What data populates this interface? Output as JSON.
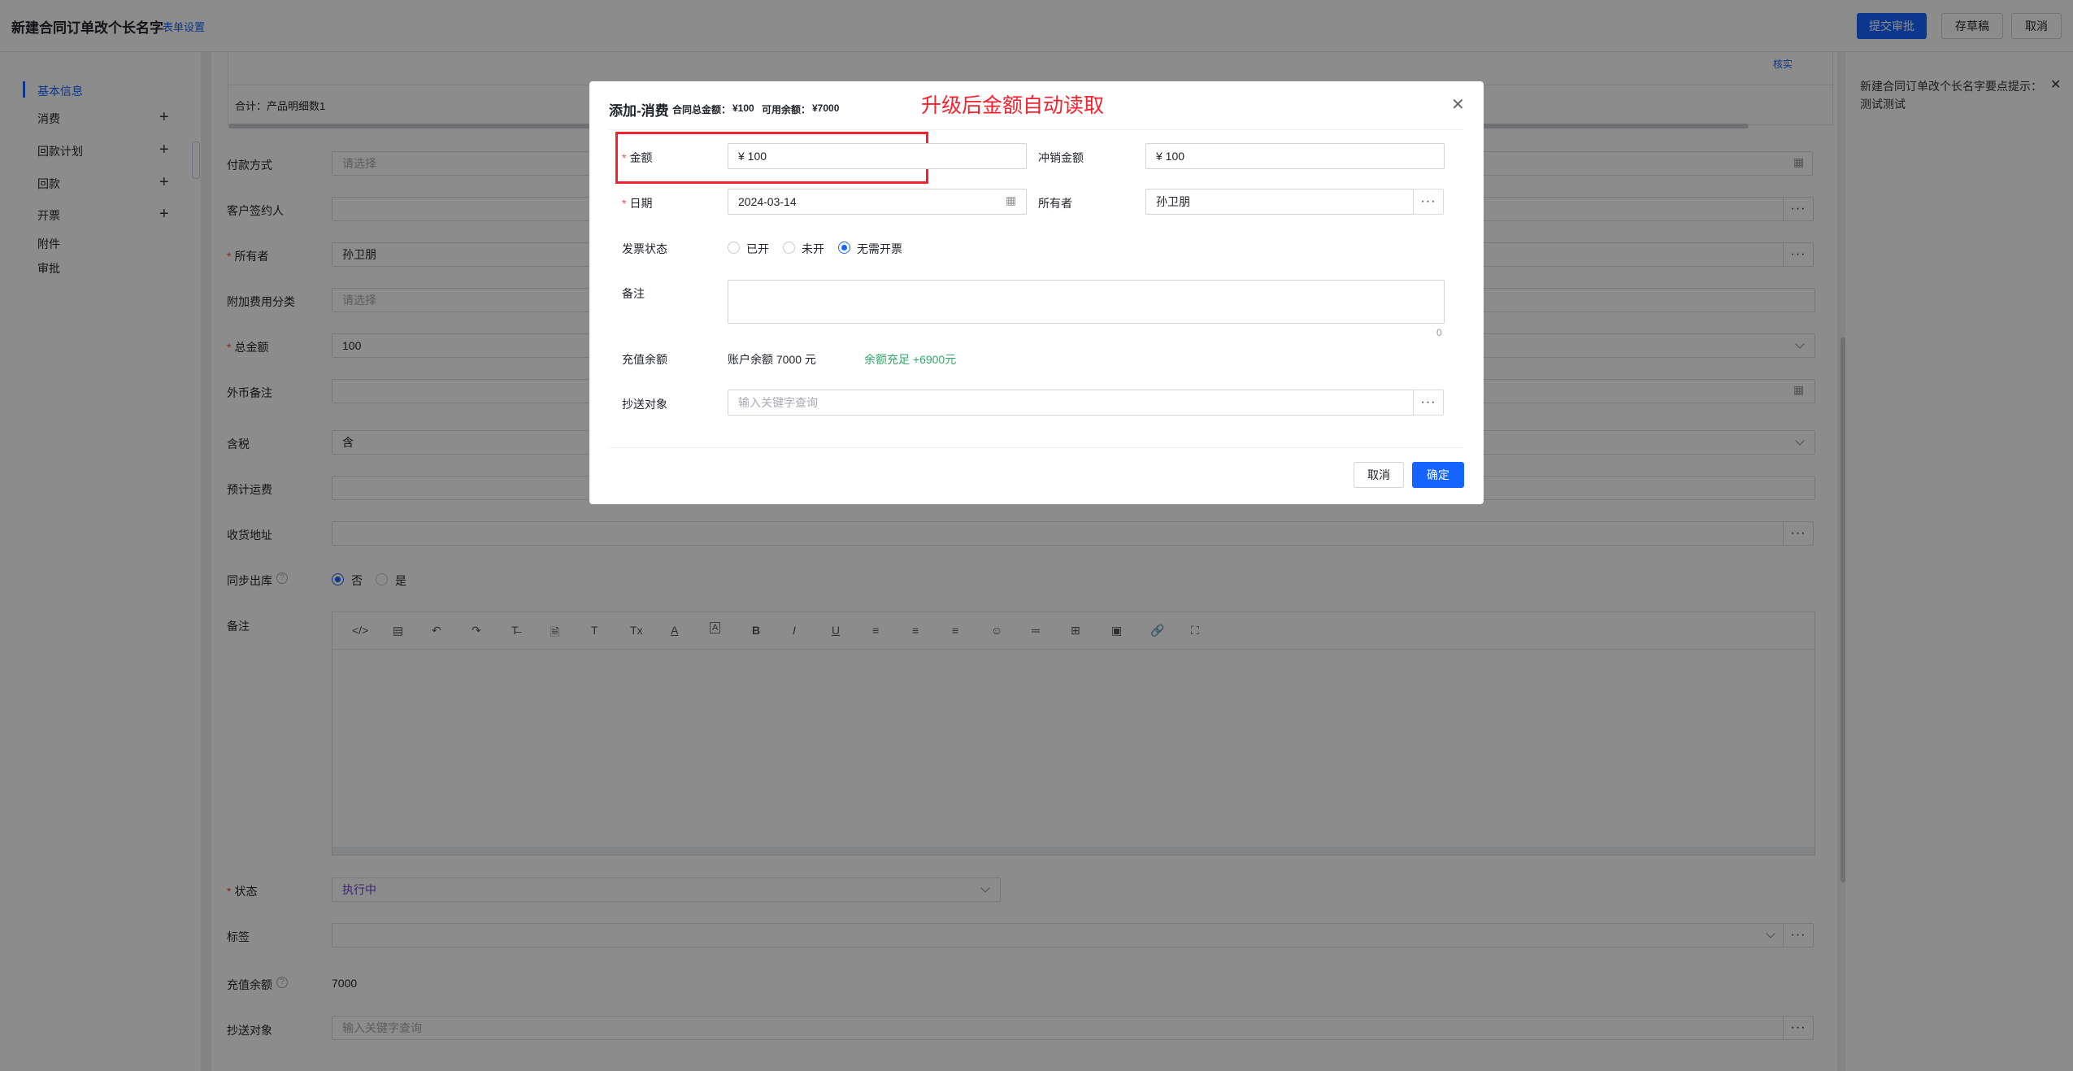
{
  "header": {
    "title": "新建合同订单改个长名字",
    "settings_link": "表单设置",
    "submit_label": "提交审批",
    "draft_label": "存草稿",
    "cancel_label": "取消"
  },
  "sidebar": {
    "items": [
      {
        "label": "基本信息",
        "active": true
      },
      {
        "label": "消费",
        "addable": true
      },
      {
        "label": "回款计划",
        "addable": true
      },
      {
        "label": "回款",
        "addable": true
      },
      {
        "label": "开票",
        "addable": true
      },
      {
        "label": "附件"
      },
      {
        "label": "审批"
      }
    ]
  },
  "table": {
    "summary": "合计：产品明细数1",
    "header_partial": "核实"
  },
  "form": {
    "payment_method": {
      "label": "付款方式",
      "placeholder": "请选择"
    },
    "customer_signer": {
      "label": "客户签约人"
    },
    "owner": {
      "label": "所有者",
      "value": "孙卫朋"
    },
    "extra_fee_category": {
      "label": "附加费用分类",
      "placeholder": "请选择"
    },
    "total_amount": {
      "label": "总金额",
      "value": "100"
    },
    "foreign_note": {
      "label": "外币备注"
    },
    "tax": {
      "label": "含税",
      "value": "含"
    },
    "estimated_freight": {
      "label": "预计运费"
    },
    "shipping_address": {
      "label": "收货地址"
    },
    "sync_outbound": {
      "label": "同步出库",
      "options": [
        "否",
        "是"
      ],
      "selected": "否"
    },
    "remarks": {
      "label": "备注"
    },
    "status": {
      "label": "状态",
      "value": "执行中"
    },
    "tags": {
      "label": "标签"
    },
    "recharge_balance": {
      "label": "充值余额",
      "value": "7000"
    },
    "cc": {
      "label": "抄送对象",
      "placeholder": "输入关键字查询"
    }
  },
  "editor_toolbar": [
    "</>",
    "▤",
    "↶",
    "↷",
    "T̶",
    "🗎",
    "T",
    "Tx",
    "A",
    "A",
    "B",
    "I",
    "U",
    "≡",
    "≡",
    "≡",
    "☺",
    "═",
    "⊞",
    "▣",
    "🔗",
    "⛶"
  ],
  "right_panel": {
    "title": "新建合同订单改个长名字要点提示：",
    "content": "测试测试"
  },
  "modal": {
    "title": "添加-消费",
    "contract_total_label": "合同总金额：",
    "contract_total": "¥100",
    "available_balance_label": "可用余额：",
    "available_balance": "¥7000",
    "annotation": "升级后金额自动读取",
    "amount": {
      "label": "金额",
      "value": "¥ 100"
    },
    "offset_amount": {
      "label": "冲销金额",
      "value": "¥ 100"
    },
    "date": {
      "label": "日期",
      "value": "2024-03-14"
    },
    "owner": {
      "label": "所有者",
      "value": "孙卫朋"
    },
    "invoice_status": {
      "label": "发票状态",
      "options": [
        "已开",
        "未开",
        "无需开票"
      ],
      "selected": "无需开票"
    },
    "remarks": {
      "label": "备注",
      "count": "0"
    },
    "recharge_balance": {
      "label": "充值余额",
      "value": "账户余额 7000 元",
      "hint": "余额充足 +6900元"
    },
    "cc": {
      "label": "抄送对象",
      "placeholder": "输入关键字查询"
    },
    "cancel_label": "取消",
    "confirm_label": "确定"
  },
  "colors": {
    "primary": "#1664ff",
    "annotation": "#f5222d",
    "success": "#2fa86a",
    "required": "#f54a45"
  }
}
